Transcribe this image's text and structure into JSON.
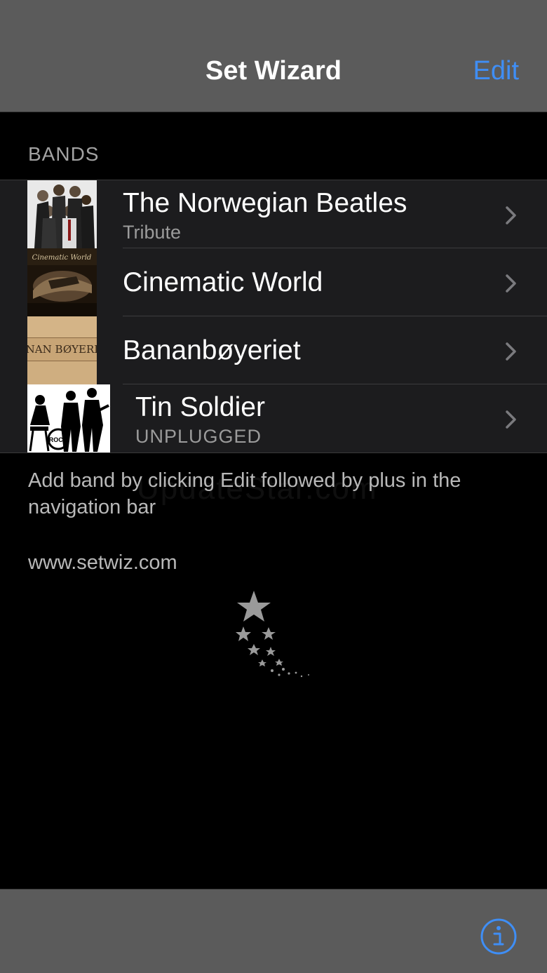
{
  "nav": {
    "title": "Set Wizard",
    "edit_label": "Edit"
  },
  "section": {
    "header": "BANDS"
  },
  "bands": [
    {
      "name": "The Norwegian Beatles",
      "subtitle": "Tribute",
      "thumb": "band-photo-icon"
    },
    {
      "name": "Cinematic World",
      "subtitle": "",
      "thumb": "cinematic-world-cover-icon",
      "thumb_text": "Cinematic World"
    },
    {
      "name": "Bananbøyeriet",
      "subtitle": "",
      "thumb": "wooden-crate-logo-icon",
      "thumb_text": "BANAN BØYERIET"
    },
    {
      "name": "Tin Soldier",
      "subtitle": "UNPLUGGED",
      "thumb": "band-silhouette-icon",
      "thumb_text": "ROCK"
    }
  ],
  "footer": {
    "hint": "Add band by clicking Edit followed by plus in the navigation bar",
    "website": "www.setwiz.com",
    "watermark": "UpdateStar.com"
  },
  "icons": {
    "chevron": "chevron-right-icon",
    "info": "info-icon",
    "logo": "shooting-stars-icon"
  },
  "colors": {
    "accent": "#3f8ef5",
    "bar": "#5b5b5b",
    "background": "#000000",
    "cell": "#1c1c1e"
  }
}
